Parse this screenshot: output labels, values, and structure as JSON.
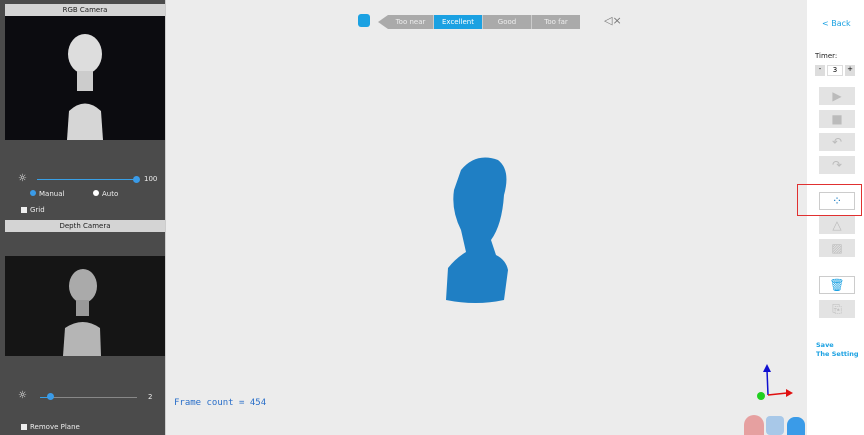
{
  "rgb_camera": {
    "title": "RGB Camera",
    "brightness_value": "100",
    "brightness_level": 100,
    "mode_manual": "Manual",
    "mode_auto": "Auto",
    "selected_mode": "Manual",
    "grid_label": "Grid"
  },
  "depth_camera": {
    "title": "Depth Camera",
    "value": "2",
    "level": 2,
    "remove_plane_label": "Remove Plane"
  },
  "distance": {
    "segments": [
      "Too near",
      "Excellent",
      "Good",
      "Too far"
    ],
    "active": "Excellent"
  },
  "frame_count": "Frame count = 454",
  "right_panel": {
    "back_label": "< Back",
    "timer_label": "Timer:",
    "timer_minus": "-",
    "timer_value": "3",
    "timer_plus": "+",
    "save_label_1": "Save",
    "save_label_2": "The Setting"
  },
  "colors": {
    "accent": "#1ba1e2",
    "mesh": "#1f7fc4",
    "highlight": "#e03030"
  }
}
